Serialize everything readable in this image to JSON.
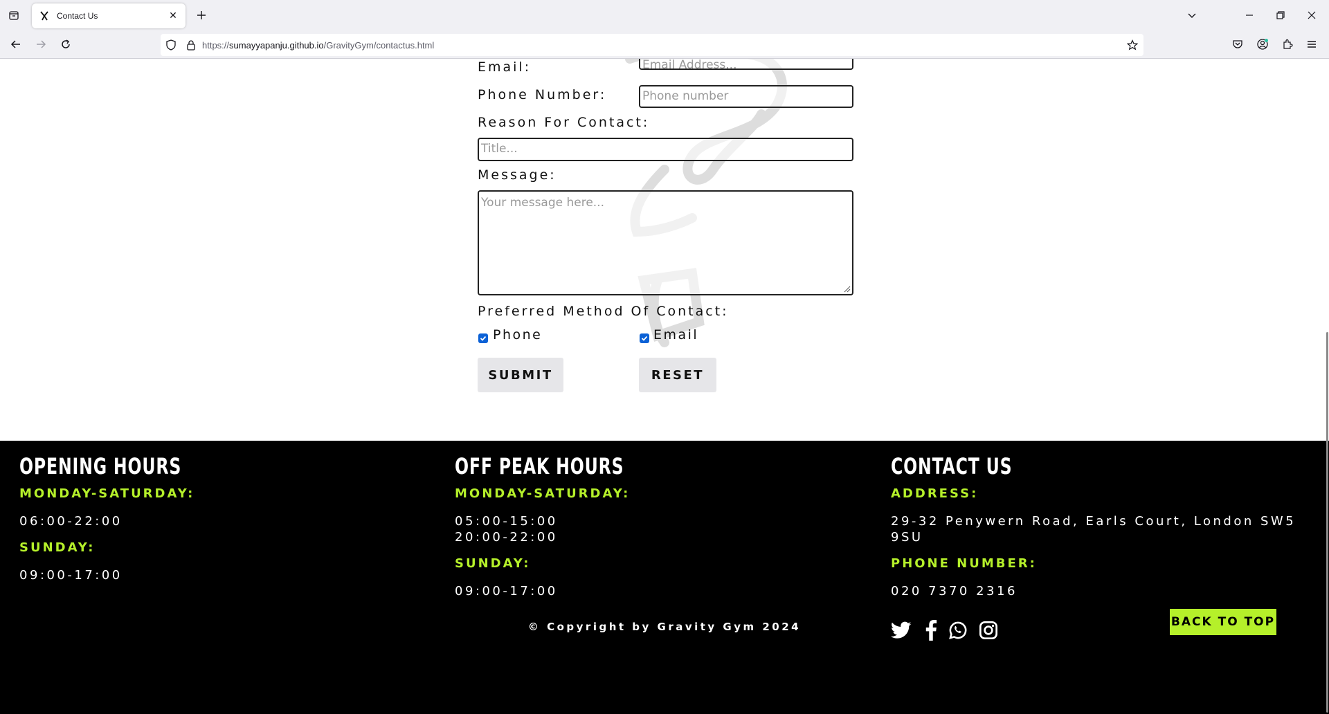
{
  "browser": {
    "tab_title": "Contact Us",
    "url_prefix": "https://",
    "url_host": "sumayyapanju.github.io",
    "url_path": "/GravityGym/contactus.html"
  },
  "form": {
    "email_label": "Email:",
    "email_placeholder": "Email Address...",
    "phone_label": "Phone Number:",
    "phone_placeholder": "Phone number",
    "reason_label": "Reason For Contact:",
    "reason_placeholder": "Title...",
    "message_label": "Message:",
    "message_placeholder": "Your message here...",
    "method_label": "Preferred Method Of Contact:",
    "phone_option": "Phone",
    "email_option": "Email",
    "phone_checked": true,
    "email_checked": true,
    "submit_label": "SUBMIT",
    "reset_label": "RESET"
  },
  "footer": {
    "opening": {
      "title": "OPENING HOURS",
      "weekday_label": "MONDAY-SATURDAY:",
      "weekday_hours": "06:00-22:00",
      "sunday_label": "SUNDAY:",
      "sunday_hours": "09:00-17:00"
    },
    "offpeak": {
      "title": "OFF PEAK HOURS",
      "weekday_label": "MONDAY-SATURDAY:",
      "weekday_hours_1": "05:00-15:00",
      "weekday_hours_2": "20:00-22:00",
      "sunday_label": "SUNDAY:",
      "sunday_hours": "09:00-17:00"
    },
    "contact": {
      "title": "CONTACT US",
      "address_label": "ADDRESS:",
      "address_line_1": "29-32 Penywern Road, Earls Court, London SW5",
      "address_line_2": "9SU",
      "phone_label": "PHONE NUMBER:",
      "phone_value": "020 7370 2316"
    },
    "social_icons": [
      "twitter-icon",
      "facebook-icon",
      "whatsapp-icon",
      "instagram-icon"
    ],
    "copyright": "© Copyright by Gravity Gym 2024",
    "back_to_top": "BACK TO TOP"
  },
  "colors": {
    "accent": "#b5f02a",
    "footer_bg": "#000000",
    "checkbox": "#0b61d6"
  }
}
